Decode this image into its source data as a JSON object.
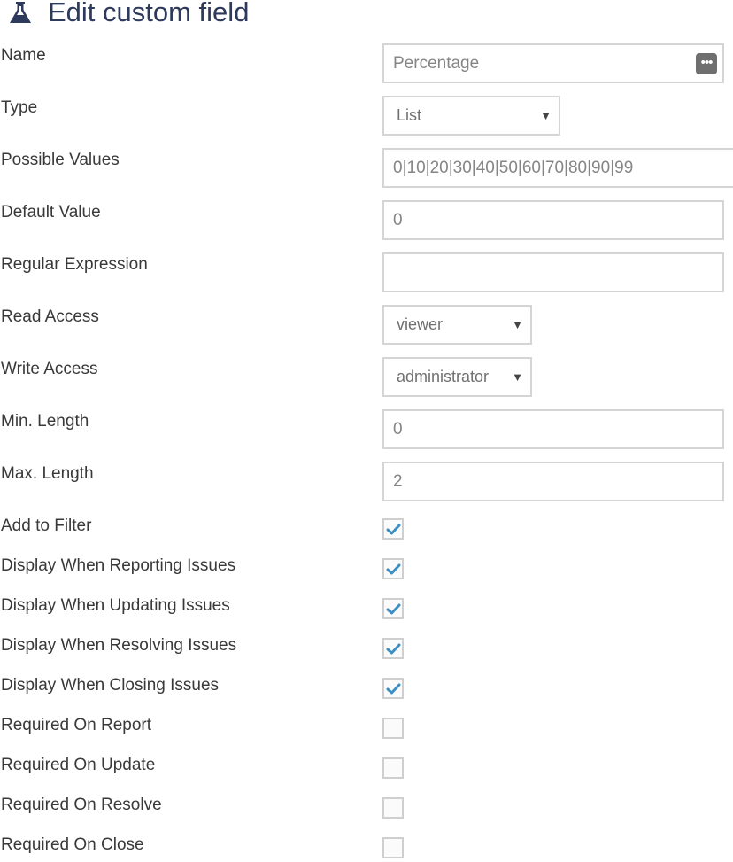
{
  "page": {
    "title": "Edit custom field"
  },
  "fields": {
    "name": {
      "label": "Name",
      "value": "Percentage"
    },
    "type": {
      "label": "Type",
      "selected": "List"
    },
    "possible_values": {
      "label": "Possible Values",
      "value": "0|10|20|30|40|50|60|70|80|90|99"
    },
    "default_value": {
      "label": "Default Value",
      "value": "0"
    },
    "regular_expression": {
      "label": "Regular Expression",
      "value": ""
    },
    "read_access": {
      "label": "Read Access",
      "selected": "viewer"
    },
    "write_access": {
      "label": "Write Access",
      "selected": "administrator"
    },
    "min_length": {
      "label": "Min. Length",
      "value": "0"
    },
    "max_length": {
      "label": "Max. Length",
      "value": "2"
    }
  },
  "checkboxes": [
    {
      "label": "Add to Filter",
      "checked": true
    },
    {
      "label": "Display When Reporting Issues",
      "checked": true
    },
    {
      "label": "Display When Updating Issues",
      "checked": true
    },
    {
      "label": "Display When Resolving Issues",
      "checked": true
    },
    {
      "label": "Display When Closing Issues",
      "checked": true
    },
    {
      "label": "Required On Report",
      "checked": false
    },
    {
      "label": "Required On Update",
      "checked": false
    },
    {
      "label": "Required On Resolve",
      "checked": false
    },
    {
      "label": "Required On Close",
      "checked": false
    }
  ],
  "icons": {
    "title_icon": "flask-icon",
    "name_action": "ellipsis-icon",
    "dropdown": "caret-down-icon",
    "check": "checkmark-icon"
  },
  "colors": {
    "title": "#2e3a5c",
    "check": "#3a8fc7",
    "border": "#d5d5d5"
  }
}
